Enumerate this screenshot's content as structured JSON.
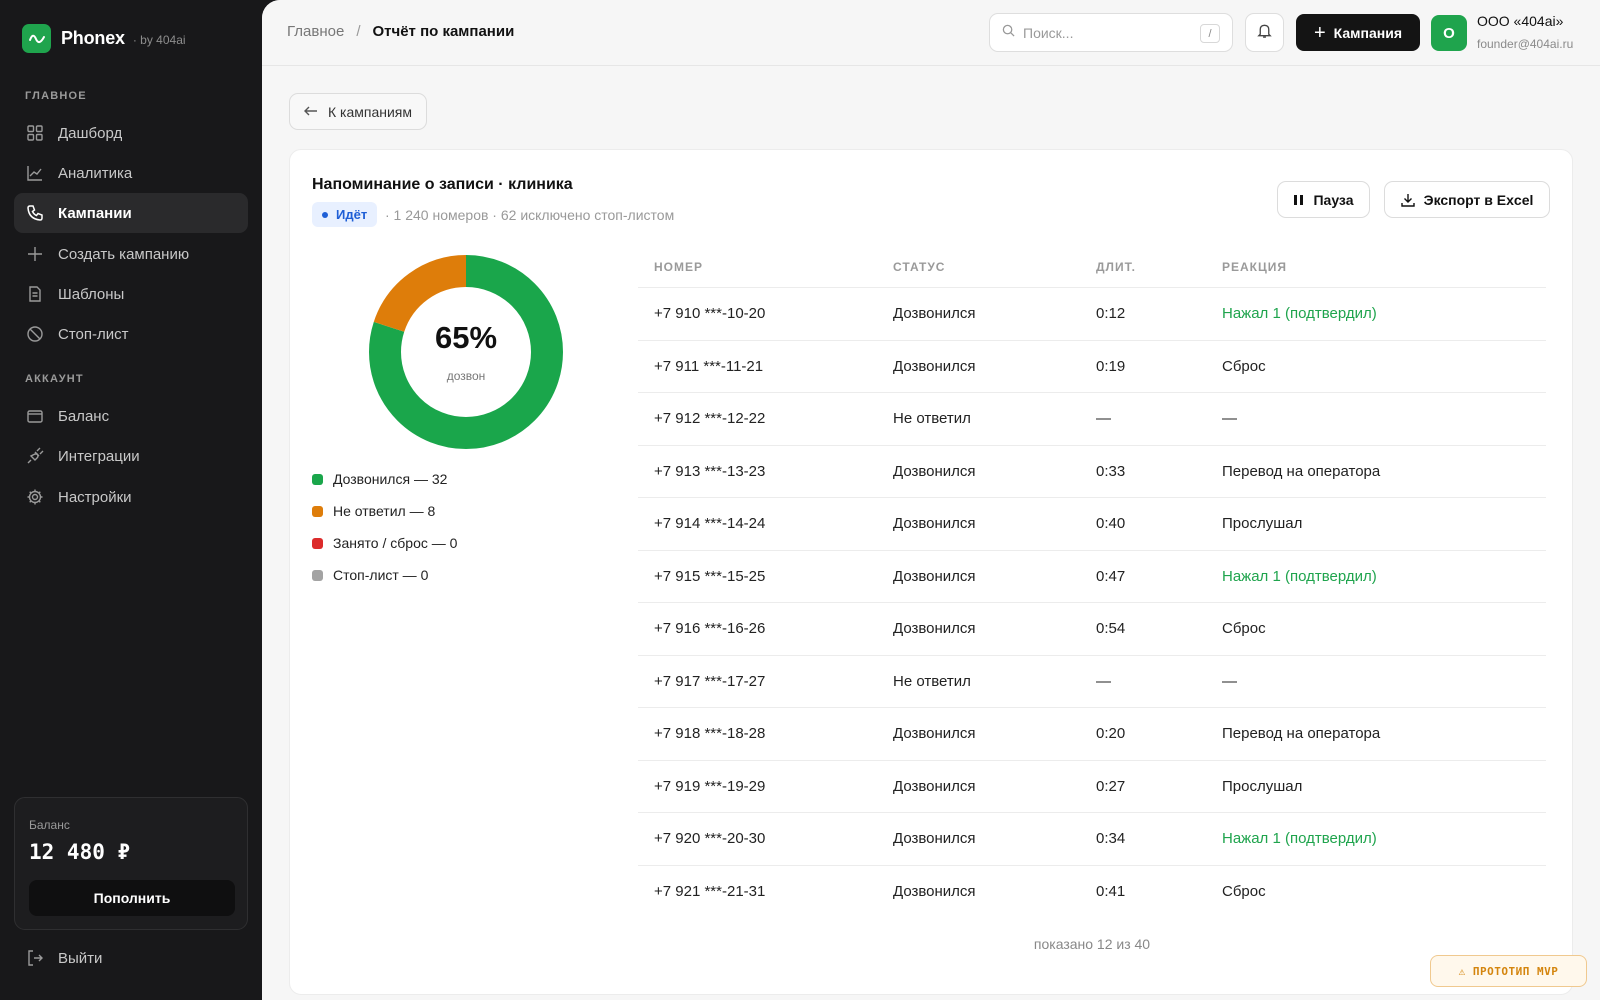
{
  "brand": {
    "name": "Phonex",
    "sub": "· by 404ai"
  },
  "sidebar": {
    "section_main": "ГЛАВНОЕ",
    "section_account": "АККАУНТ",
    "items": [
      {
        "label": "Дашборд",
        "icon": "grid-icon"
      },
      {
        "label": "Аналитика",
        "icon": "chart-line-icon"
      },
      {
        "label": "Кампании",
        "icon": "phone-icon",
        "active": true
      },
      {
        "label": "Создать кампанию",
        "icon": "plus-icon"
      },
      {
        "label": "Шаблоны",
        "icon": "document-icon"
      },
      {
        "label": "Стоп-лист",
        "icon": "ban-icon"
      }
    ],
    "account_items": [
      {
        "label": "Баланс",
        "icon": "wallet-icon"
      },
      {
        "label": "Интеграции",
        "icon": "plug-icon"
      },
      {
        "label": "Настройки",
        "icon": "gear-icon"
      }
    ],
    "balance": {
      "label": "Баланс",
      "value": "12 480 ₽",
      "topup_label": "Пополнить"
    },
    "logout_label": "Выйти"
  },
  "header": {
    "breadcrumb_home": "Главное",
    "breadcrumb_sep": "/",
    "breadcrumb_current": "Отчёт по кампании",
    "search_placeholder": "Поиск...",
    "search_shortcut": "/",
    "campaign_button": "Кампания",
    "avatar_letter": "О",
    "org_name": "ООО «404ai»",
    "org_email": "founder@404ai.ru"
  },
  "back_label": "К кампаниям",
  "campaign": {
    "title": "Напоминание о записи · клиника",
    "status": "Идёт",
    "meta": "· 1 240 номеров · 62 исключено стоп-листом",
    "pause_label": "Пауза",
    "export_label": "Экспорт в Excel"
  },
  "donut": {
    "percent": "65%",
    "subtitle": "дозвон",
    "segments": [
      {
        "label": "Дозвонился — 32",
        "value": 32,
        "color": "#1aa64b"
      },
      {
        "label": "Не ответил — 8",
        "value": 8,
        "color": "#de7d0a"
      },
      {
        "label": "Занято / сброс — 0",
        "value": 0,
        "color": "#dc2b2b"
      },
      {
        "label": "Стоп-лист — 0",
        "value": 0,
        "color": "#a3a3a3"
      }
    ]
  },
  "table": {
    "headers": [
      "НОМЕР",
      "СТАТУС",
      "ДЛИТ.",
      "РЕАКЦИЯ"
    ],
    "rows": [
      [
        "+7 910 ***-10-20",
        "Дозвонился",
        "0:12",
        "Нажал 1 (подтвердил)"
      ],
      [
        "+7 911 ***-11-21",
        "Дозвонился",
        "0:19",
        "Сброс"
      ],
      [
        "+7 912 ***-12-22",
        "Не ответил",
        "—",
        "—"
      ],
      [
        "+7 913 ***-13-23",
        "Дозвонился",
        "0:33",
        "Перевод на оператора"
      ],
      [
        "+7 914 ***-14-24",
        "Дозвонился",
        "0:40",
        "Прослушал"
      ],
      [
        "+7 915 ***-15-25",
        "Дозвонился",
        "0:47",
        "Нажал 1 (подтвердил)"
      ],
      [
        "+7 916 ***-16-26",
        "Дозвонился",
        "0:54",
        "Сброс"
      ],
      [
        "+7 917 ***-17-27",
        "Не ответил",
        "—",
        "—"
      ],
      [
        "+7 918 ***-18-28",
        "Дозвонился",
        "0:20",
        "Перевод на оператора"
      ],
      [
        "+7 919 ***-19-29",
        "Дозвонился",
        "0:27",
        "Прослушал"
      ],
      [
        "+7 920 ***-20-30",
        "Дозвонился",
        "0:34",
        "Нажал 1 (подтвердил)"
      ],
      [
        "+7 921 ***-21-31",
        "Дозвонился",
        "0:41",
        "Сброс"
      ]
    ],
    "footer": "показано 12 из 40"
  },
  "proto_badge": "⚠ ПРОТОТИП MVP",
  "colors": {
    "accent": "#1fa44d",
    "dark": "#18181a",
    "status_blue": "#1f5fd6",
    "warning": "#d4850e"
  }
}
